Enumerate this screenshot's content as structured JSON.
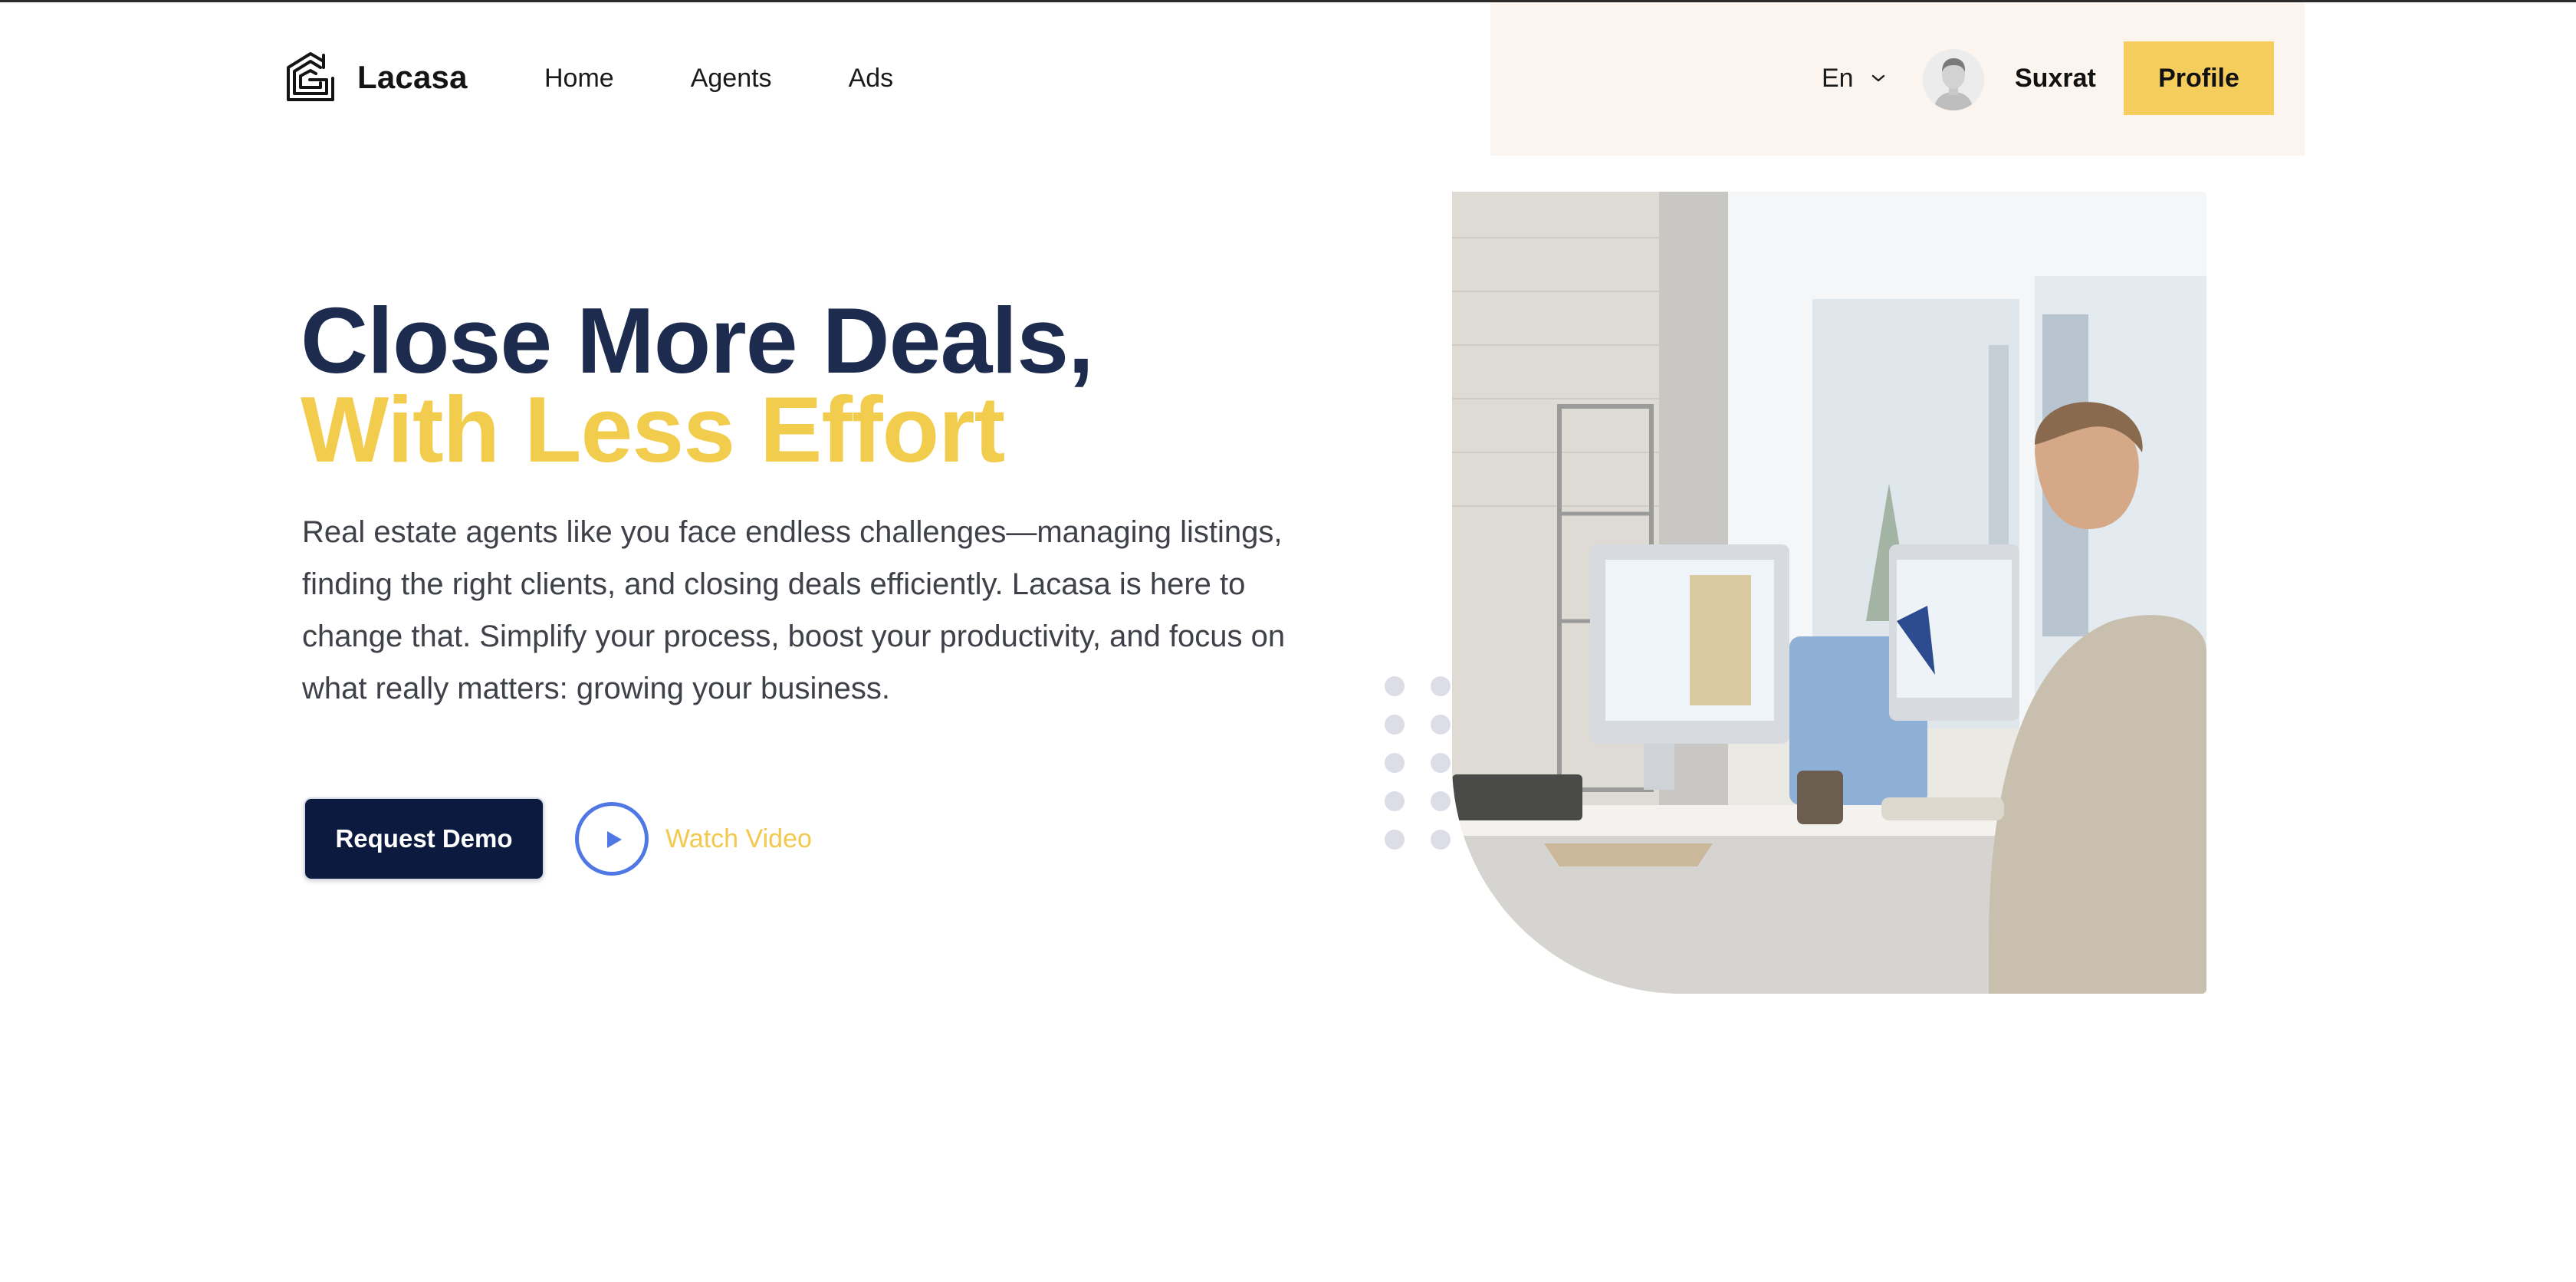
{
  "header": {
    "brand": "Lacasa",
    "nav": [
      {
        "label": "Home"
      },
      {
        "label": "Agents"
      },
      {
        "label": "Ads"
      }
    ],
    "language": "En",
    "username": "Suxrat",
    "profile_button": "Profile"
  },
  "hero": {
    "title_dark": "Close More Deals,",
    "title_accent": "With Less Effort",
    "description": "Real estate agents like you face endless challenges—managing listings, finding the right clients, and closing deals efficiently. Lacasa is here to change that. Simplify your process, boost your productivity, and focus on what really matters: growing your business.",
    "demo_button": "Request Demo",
    "watch_video": "Watch Video"
  },
  "icons": {
    "logo": "lacasa-logo-icon",
    "language": "chevron-down-icon",
    "avatar": "user-avatar",
    "play": "play-icon"
  },
  "colors": {
    "primary_dark": "#1d2b4f",
    "accent_yellow": "#f2cc4c",
    "button_dark": "#0d1a3f",
    "play_blue": "#4f78e4",
    "header_panel": "#fbf4ef",
    "profile_button": "#f5cd5d"
  }
}
